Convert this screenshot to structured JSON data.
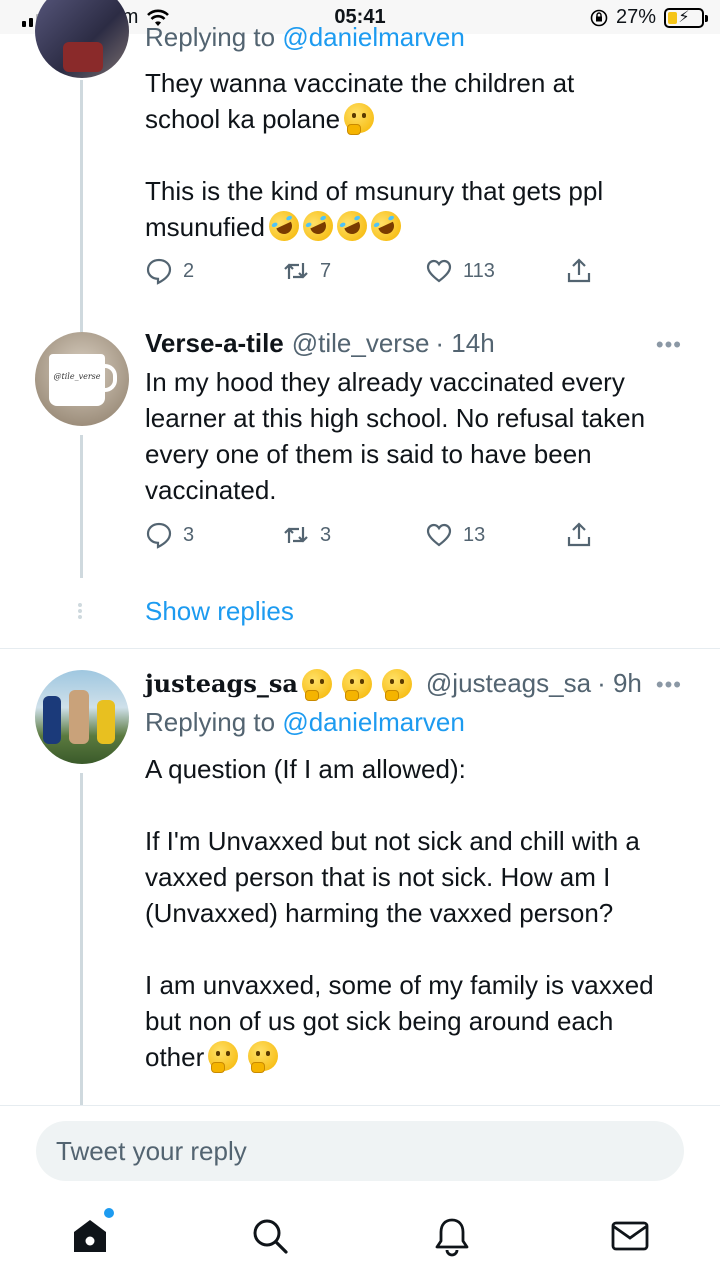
{
  "status_bar": {
    "carrier": "Vodacom",
    "time": "05:41",
    "battery": "27%"
  },
  "tweets": [
    {
      "replying_to_label": "Replying to",
      "replying_to_handle": "@danielmarven",
      "text_1": "They wanna vaccinate the children at\nschool ka polane",
      "text_2": "This is the kind of msunury that gets ppl\nmsunufied",
      "replies": "2",
      "retweets": "7",
      "likes": "113"
    },
    {
      "name": "Verse-a-tile",
      "handle": "@tile_verse",
      "time": "· 14h",
      "avatar_text": "@tile_verse",
      "text": "In my hood they already vaccinated every\nlearner at this high school. No refusal taken\nevery one of them is said to have been\nvaccinated.",
      "replies": "3",
      "retweets": "3",
      "likes": "13"
    },
    {
      "name": "justeags_sa",
      "handle": "@justeags_sa",
      "time": "· 9h",
      "replying_to_label": "Replying to",
      "replying_to_handle": "@danielmarven",
      "text_1": "A question (If I am allowed):\n\nIf I'm Unvaxxed but not sick and chill with a\nvaxxed person that is not sick. How am I\n(Unvaxxed) harming the vaxxed person?\n\nI am unvaxxed, some of my family is vaxxed\nbut non of us got sick being around each\nother"
    }
  ],
  "show_replies": "Show replies",
  "more_menu": "•••",
  "reply_placeholder": "Tweet your reply",
  "icons": {
    "reply": "speech-bubble",
    "retweet": "retweet-arrows",
    "like": "heart",
    "share": "share-upload",
    "home": "home",
    "search": "magnifier",
    "notifications": "bell",
    "messages": "envelope"
  },
  "colors": {
    "accent": "#1d9bf0",
    "muted": "#536471",
    "text": "#0f1419",
    "thread_line": "#cfd9de"
  }
}
